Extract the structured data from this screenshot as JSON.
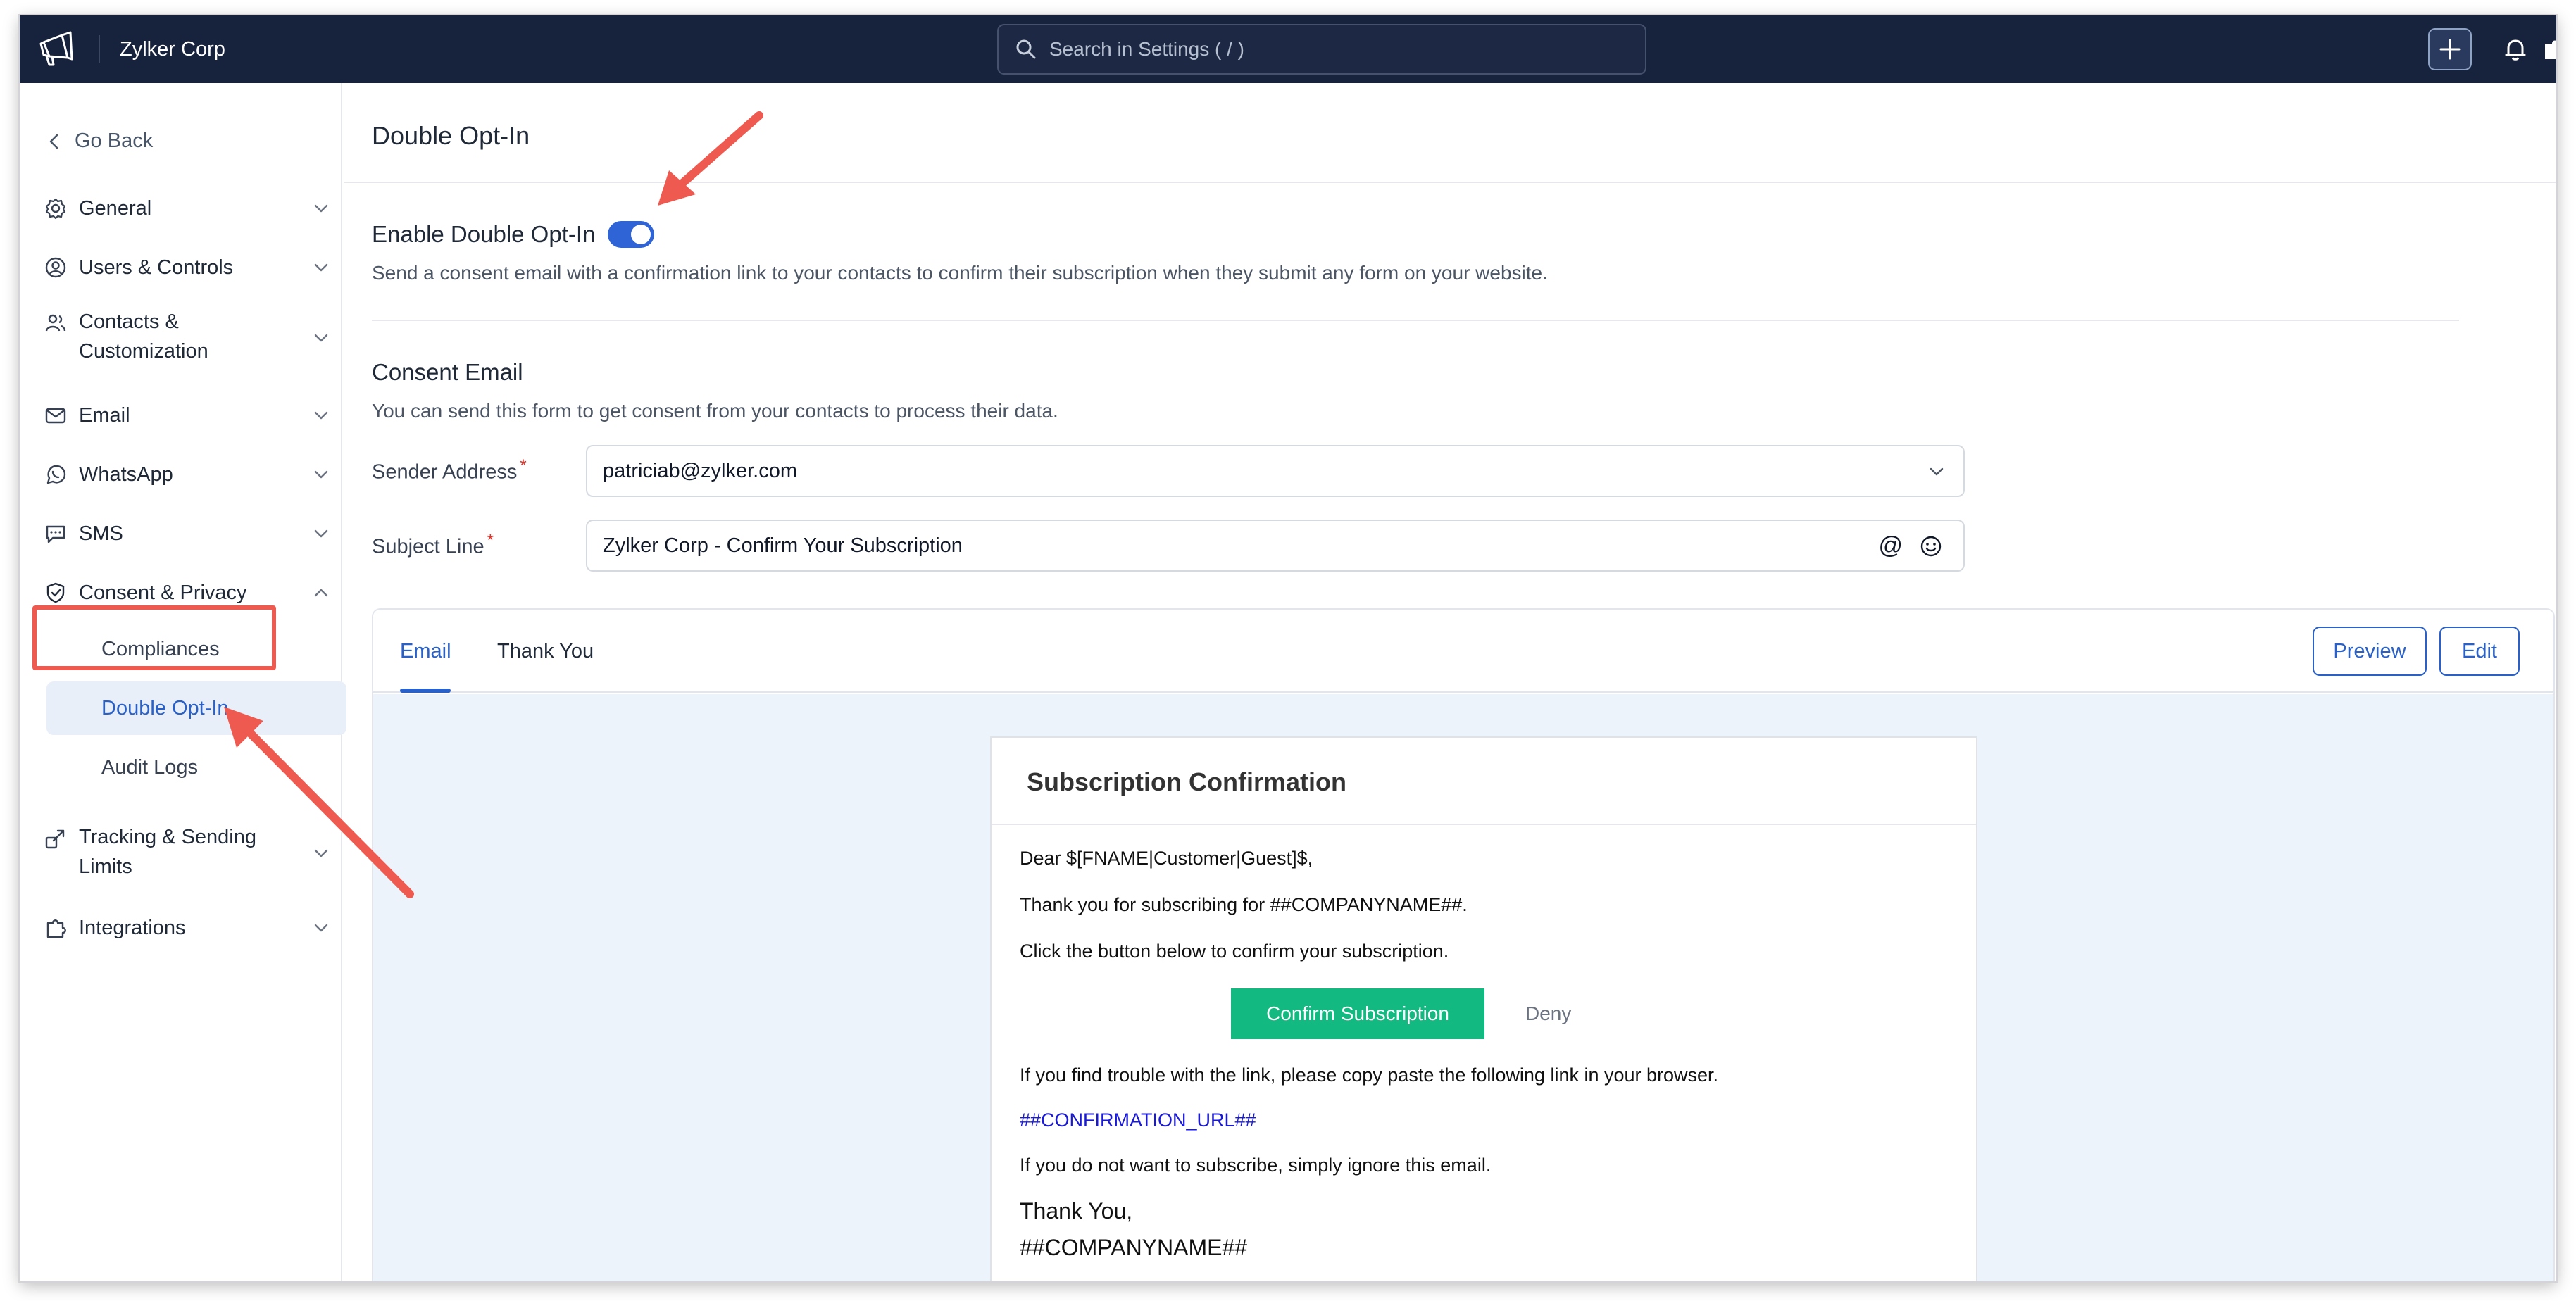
{
  "topbar": {
    "org_name": "Zylker Corp",
    "search_placeholder": "Search in Settings ( / )",
    "icons": [
      "megaphone-logo-icon",
      "search-icon",
      "plus-icon",
      "bell-icon"
    ]
  },
  "sidebar": {
    "go_back": "Go Back",
    "items": [
      {
        "label": "General",
        "icon": "gear-icon"
      },
      {
        "label": "Users & Controls",
        "icon": "user-circle-icon"
      },
      {
        "label": "Contacts &\nCustomization",
        "icon": "contacts-icon"
      },
      {
        "label": "Email",
        "icon": "envelope-icon"
      },
      {
        "label": "WhatsApp",
        "icon": "whatsapp-icon"
      },
      {
        "label": "SMS",
        "icon": "sms-icon"
      },
      {
        "label": "Consent & Privacy",
        "icon": "shield-icon"
      },
      {
        "label": "Tracking & Sending\nLimits",
        "icon": "tracking-icon"
      },
      {
        "label": "Integrations",
        "icon": "puzzle-icon"
      }
    ],
    "sub_items": [
      "Compliances",
      "Double Opt-In",
      "Audit Logs"
    ],
    "active_sub_item": "Double Opt-In"
  },
  "main": {
    "page_title": "Double Opt-In",
    "enable_label": "Enable Double Opt-In",
    "enable_on": true,
    "enable_description": "Send a consent email with a confirmation link to your contacts to confirm their subscription when they submit any form on your website.",
    "consent_title": "Consent Email",
    "consent_description": "You can send this form to get consent from your contacts to process their data.",
    "sender_label": "Sender Address",
    "sender_value": "patriciab@zylker.com",
    "subject_label": "Subject Line",
    "subject_value": "Zylker Corp - Confirm Your Subscription",
    "required_mark": "*",
    "at_symbol": "@"
  },
  "panel": {
    "tabs": [
      "Email",
      "Thank You"
    ],
    "active_tab": "Email",
    "preview_label": "Preview",
    "edit_label": "Edit"
  },
  "email": {
    "title": "Subscription Confirmation",
    "greeting": "Dear $[FNAME|Customer|Guest]$,",
    "thanks_line": "Thank you for subscribing for ##COMPANYNAME##.",
    "instruction": "Click the button below to confirm your subscription.",
    "confirm_label": "Confirm Subscription",
    "deny_label": "Deny",
    "trouble_line": "If you find trouble with the link, please copy paste the following link in your browser.",
    "confirmation_url": "##CONFIRMATION_URL##",
    "ignore_line": "If you do not want to subscribe, simply ignore this email.",
    "signoff_1": "Thank You,",
    "signoff_2": "##COMPANYNAME##"
  },
  "colors": {
    "topbar": "#17223c",
    "accent": "#2a61c8",
    "confirm_button": "#12b981",
    "annotation": "#ee5a4f",
    "required": "#e0342a"
  }
}
